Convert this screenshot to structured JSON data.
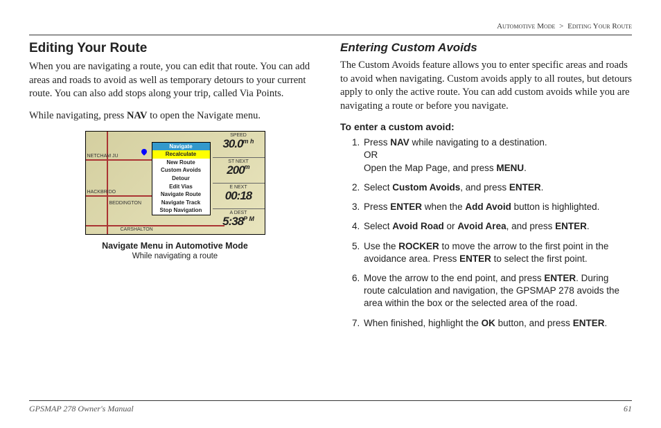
{
  "breadcrumb": {
    "section": "Automotive Mode",
    "sep": ">",
    "page": "Editing Your Route"
  },
  "left": {
    "h2": "Editing Your Route",
    "p1": "When you are navigating a route, you can edit that route. You can add areas and roads to avoid as well as temporary detours to your current route. You can also add stops along your trip, called Via Points.",
    "p2_a": "While navigating, press ",
    "p2_nav": "NAV",
    "p2_b": " to open the Navigate menu.",
    "fig": {
      "menu_title": "Navigate",
      "items": [
        "Recalculate",
        "New Route",
        "Custom Avoids",
        "Detour",
        "Edit Vias",
        "Navigate Route",
        "Navigate Track",
        "Stop Navigation"
      ],
      "side": [
        {
          "label": "SPEED",
          "val": "30.0",
          "unit": "m h"
        },
        {
          "label": "ST NEXT",
          "val": "200",
          "unit": "m"
        },
        {
          "label": "E NEXT",
          "val": "00:18",
          "unit": ""
        },
        {
          "label": "A DEST",
          "val": "5:38",
          "unit": "P M"
        }
      ],
      "map_labels": {
        "a": "NETCHAM JU",
        "b": "HACKBRIDO",
        "c": "BEDDINGTON",
        "d": "CARSHALTON"
      },
      "title": "Navigate Menu in Automotive Mode",
      "sub": "While navigating a route"
    }
  },
  "right": {
    "h3": "Entering Custom Avoids",
    "p1": "The Custom Avoids feature allows you to enter specific areas and roads to avoid when navigating. Custom avoids apply to all routes, but detours apply to only the active route. You can add custom avoids while you are navigating a route or before you navigate.",
    "sub": "To enter a custom avoid:",
    "steps": {
      "s1_a": "Press ",
      "s1_nav": "NAV",
      "s1_b": " while navigating to a destination.",
      "s1_or": "OR",
      "s1_c": "Open the Map Page, and press ",
      "s1_menu": "MENU",
      "s1_d": ".",
      "s2_a": "Select ",
      "s2_ca": "Custom Avoids",
      "s2_b": ", and press ",
      "s2_enter": "ENTER",
      "s2_c": ".",
      "s3_a": "Press ",
      "s3_enter": "ENTER",
      "s3_b": " when the ",
      "s3_add": "Add Avoid",
      "s3_c": " button is highlighted.",
      "s4_a": "Select ",
      "s4_road": "Avoid Road",
      "s4_or": " or ",
      "s4_area": "Avoid Area",
      "s4_b": ", and press ",
      "s4_enter": "ENTER",
      "s4_c": ".",
      "s5_a": "Use the ",
      "s5_rocker": "ROCKER",
      "s5_b": " to move the arrow to the first point in the avoidance area. Press ",
      "s5_enter": "ENTER",
      "s5_c": " to select the first point.",
      "s6_a": "Move the arrow to the end point, and press ",
      "s6_enter": "ENTER",
      "s6_b": ". During route calculation and navigation, the GPSMAP 278 avoids the area within the box or the selected area of the road.",
      "s7_a": "When finished, highlight the ",
      "s7_ok": "OK",
      "s7_b": " button, and press ",
      "s7_enter": "ENTER",
      "s7_c": "."
    }
  },
  "footer": {
    "manual": "GPSMAP 278 Owner's Manual",
    "page": "61"
  }
}
